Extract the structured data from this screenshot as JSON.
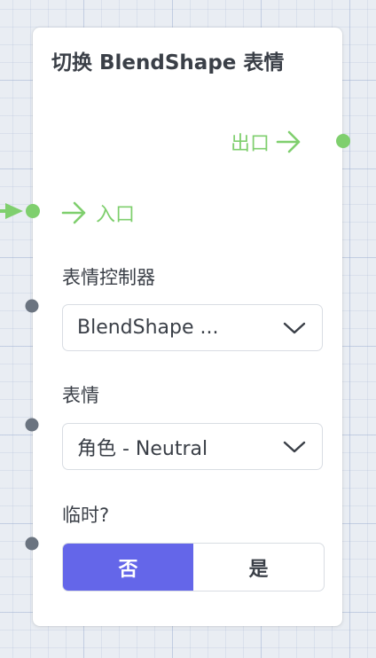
{
  "node": {
    "title": "切换 BlendShape 表情",
    "output_port": {
      "label": "出口",
      "icon": "arrow-right-icon"
    },
    "input_port": {
      "label": "入口",
      "icon": "arrow-right-icon"
    },
    "fields": {
      "controller": {
        "label": "表情控制器",
        "value": "BlendShape ..."
      },
      "expression": {
        "label": "表情",
        "value": "角色 - Neutral"
      },
      "temporary": {
        "label": "临时?",
        "options": [
          "否",
          "是"
        ],
        "selected": "否"
      }
    }
  },
  "colors": {
    "flow_green": "#7fcf6e",
    "accent": "#6466e9",
    "port_gray": "#6b7480",
    "text": "#3a3f47",
    "border": "#d9dde3"
  }
}
